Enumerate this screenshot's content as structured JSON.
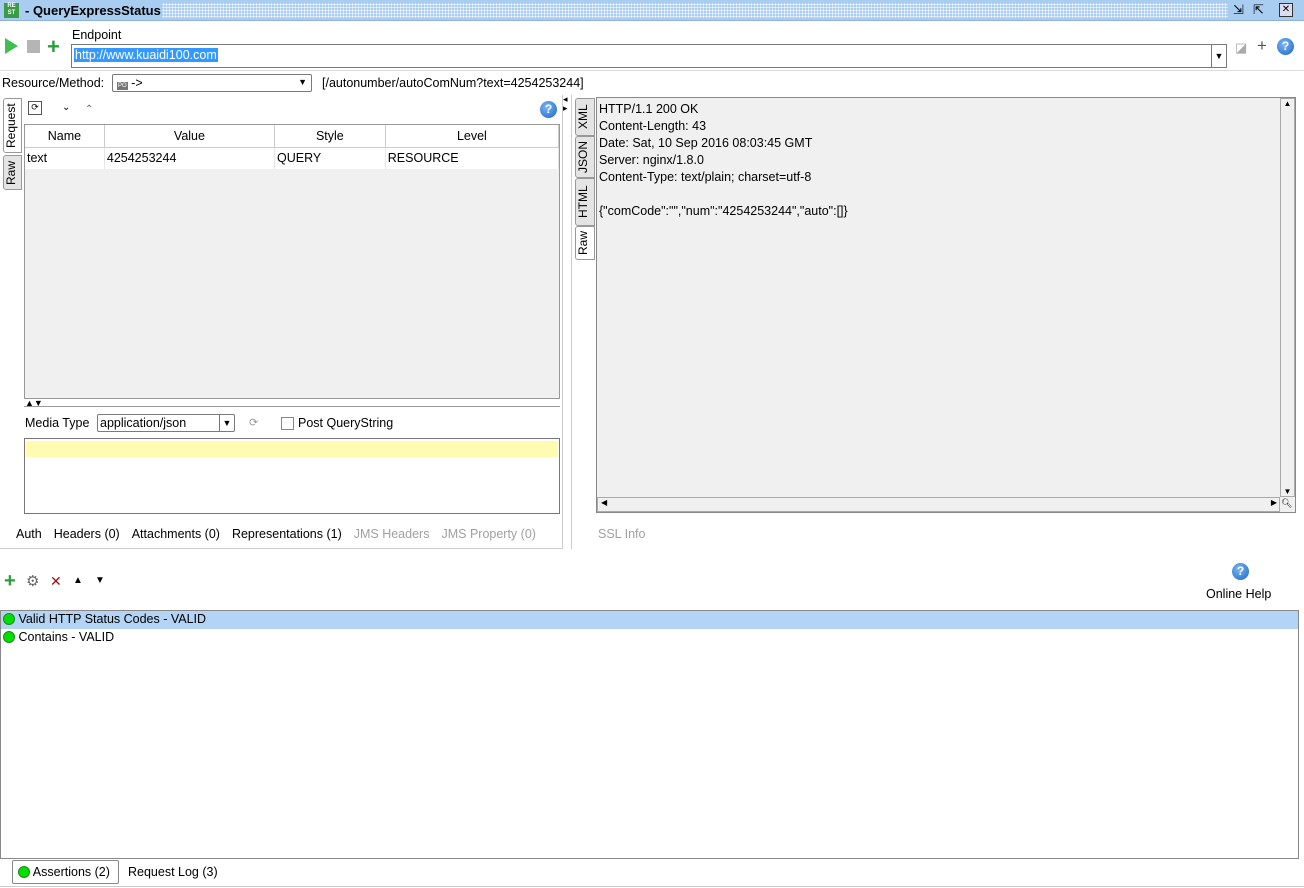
{
  "window": {
    "title": "- QueryExpressStatus",
    "icon": "rest-icon"
  },
  "toolbar": {
    "endpoint_label": "Endpoint",
    "endpoint_value": "http://www.kuaidi100.com",
    "icons": [
      "play-icon",
      "stop-icon",
      "add-icon"
    ]
  },
  "resource": {
    "label": "Resource/Method:",
    "method_value": "->",
    "path": "[/autonumber/autoComNum?text=4254253244]"
  },
  "request": {
    "tabs": [
      "Request",
      "Raw"
    ],
    "columns": [
      "Name",
      "Value",
      "Style",
      "Level"
    ],
    "rows": [
      [
        "text",
        "4254253244",
        "QUERY",
        "RESOURCE"
      ]
    ],
    "media_type_label": "Media Type",
    "media_type_value": "application/json",
    "post_querystring_label": "Post QueryString",
    "post_querystring_checked": false,
    "bottom_tabs": [
      {
        "label": "Auth",
        "enabled": true
      },
      {
        "label": "Headers (0)",
        "enabled": true
      },
      {
        "label": "Attachments (0)",
        "enabled": true
      },
      {
        "label": "Representations (1)",
        "enabled": true
      },
      {
        "label": "JMS Headers",
        "enabled": false
      },
      {
        "label": "JMS Property (0)",
        "enabled": false
      }
    ]
  },
  "response": {
    "tabs": [
      "XML",
      "JSON",
      "HTML",
      "Raw"
    ],
    "lines": [
      "HTTP/1.1 200 OK",
      "Content-Length: 43",
      "Date: Sat, 10 Sep 2016 08:03:45 GMT",
      "Server: nginx/1.8.0",
      "Content-Type: text/plain; charset=utf-8",
      "",
      "{\"comCode\":\"\",\"num\":\"4254253244\",\"auto\":[]}"
    ],
    "ssl_info": "SSL Info"
  },
  "assertions": {
    "online_help": "Online Help",
    "items": [
      {
        "label": "Valid HTTP Status Codes - VALID",
        "status": "valid"
      },
      {
        "label": "Contains - VALID",
        "status": "valid"
      }
    ],
    "status_color": "#00e000",
    "selected_color": "#b3d4f5"
  },
  "footer_tabs": [
    "Assertions (2)",
    "Request Log (3)"
  ]
}
